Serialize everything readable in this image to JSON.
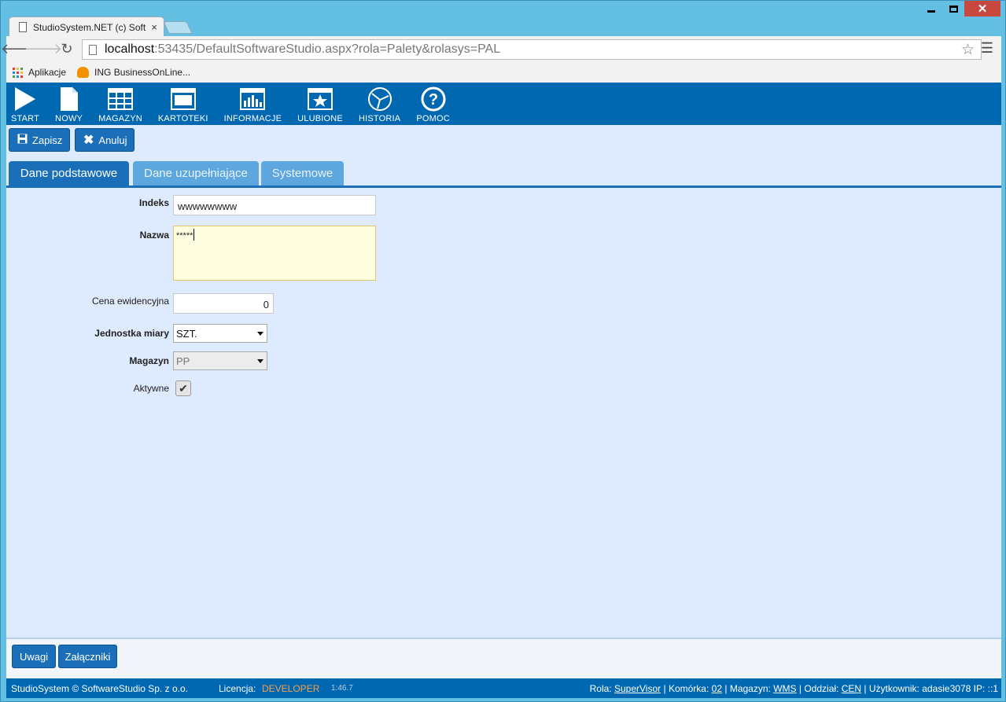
{
  "browser": {
    "tab_title": "StudioSystem.NET (c) Soft",
    "tab_close": "×",
    "url_host": "localhost",
    "url_path": ":53435/DefaultSoftwareStudio.aspx?rola=Palety&rolasys=PAL",
    "bookmarks": [
      "Aplikacje",
      "ING BusinessOnLine..."
    ]
  },
  "appbar": {
    "items": [
      "START",
      "NOWY",
      "MAGAZYN",
      "KARTOTEKI",
      "INFORMACJE",
      "ULUBIONE",
      "HISTORIA",
      "POMOC"
    ]
  },
  "actions": {
    "save": "Zapisz",
    "cancel": "Anuluj"
  },
  "form_tabs": [
    "Dane podstawowe",
    "Dane uzupełniające",
    "Systemowe"
  ],
  "form": {
    "indeks_label": "Indeks",
    "indeks_value": "wwwwwwww",
    "nazwa_label": "Nazwa",
    "nazwa_value": "*****",
    "cena_label": "Cena ewidencyjna",
    "cena_value": "0",
    "jednostka_label": "Jednostka miary",
    "jednostka_value": "SZT.",
    "magazyn_label": "Magazyn",
    "magazyn_value": "PP",
    "aktywne_label": "Aktywne",
    "aktywne_checked": true
  },
  "bottom_buttons": [
    "Uwagi",
    "Załączniki"
  ],
  "status": {
    "copyright": "StudioSystem © SoftwareStudio Sp. z o.o.",
    "licencja_label": "Licencja:",
    "licencja_value": "DEVELOPER",
    "time": "1:46.7",
    "rola_label": "Rola:",
    "rola_value": "SuperVisor",
    "komorka_label": "Komórka:",
    "komorka_value": "02",
    "magazyn_label": "Magazyn:",
    "magazyn_value": "WMS",
    "oddzial_label": "Oddział:",
    "oddzial_value": "CEN",
    "uzytkownik_label": "Użytkownik:",
    "uzytkownik_value": "adasie3078",
    "ip_label": "IP:",
    "ip_value": "::1"
  },
  "colors": {
    "brand": "#0067b1",
    "content_bg": "#deeafd",
    "license": "#f5a04c"
  }
}
